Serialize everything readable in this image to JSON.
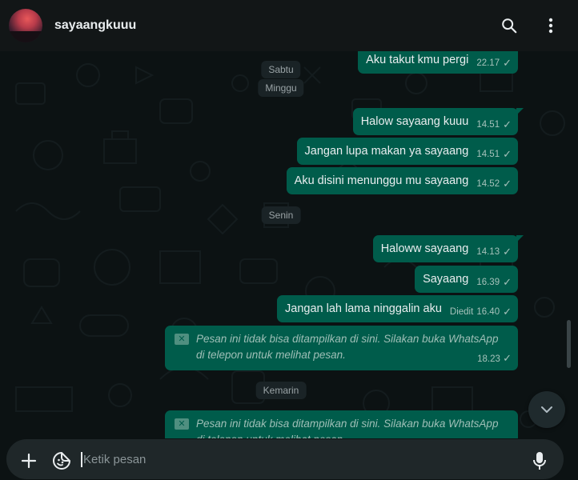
{
  "header": {
    "contact_name": "sayaangkuuu",
    "icons": [
      "avatar",
      "search-icon",
      "more-vert-icon"
    ]
  },
  "chat": {
    "date_chips": {
      "sabtu": "Sabtu",
      "minggu": "Minggu",
      "senin": "Senin",
      "kemarin": "Kemarin"
    },
    "messages": [
      {
        "text": "Aku takut kmu pergi",
        "time": "22.17",
        "status": "✓"
      },
      {
        "text": "Halow sayaang kuuu",
        "time": "14.51",
        "status": "✓"
      },
      {
        "text": "Jangan lupa makan ya sayaang",
        "time": "14.51",
        "status": "✓"
      },
      {
        "text": "Aku disini menunggu mu sayaang",
        "time": "14.52",
        "status": "✓"
      },
      {
        "text": "Haloww sayaang",
        "time": "14.13",
        "status": "✓"
      },
      {
        "text": "Sayaang",
        "time": "16.39",
        "status": "✓"
      },
      {
        "text": "Jangan lah lama ninggalin aku",
        "edited": "Diedit",
        "time": "16.40",
        "status": "✓"
      }
    ],
    "system_messages": [
      {
        "line1": "Pesan ini tidak bisa ditampilkan di sini. Silakan buka WhatsApp",
        "line2": "di telepon untuk melihat pesan.",
        "time": "18.23",
        "status": "✓"
      },
      {
        "line1": "Pesan ini tidak bisa ditampilkan di sini. Silakan buka WhatsApp",
        "line2": "di telepon untuk melihat pesan."
      }
    ]
  },
  "composer": {
    "placeholder": "Ketik pesan",
    "value": ""
  },
  "colors": {
    "header_bg": "#121617",
    "chat_bg": "#0c1213",
    "outgoing_bubble": "#005c4b",
    "composer_bg": "#1f2729",
    "text_primary": "#e9edef"
  }
}
